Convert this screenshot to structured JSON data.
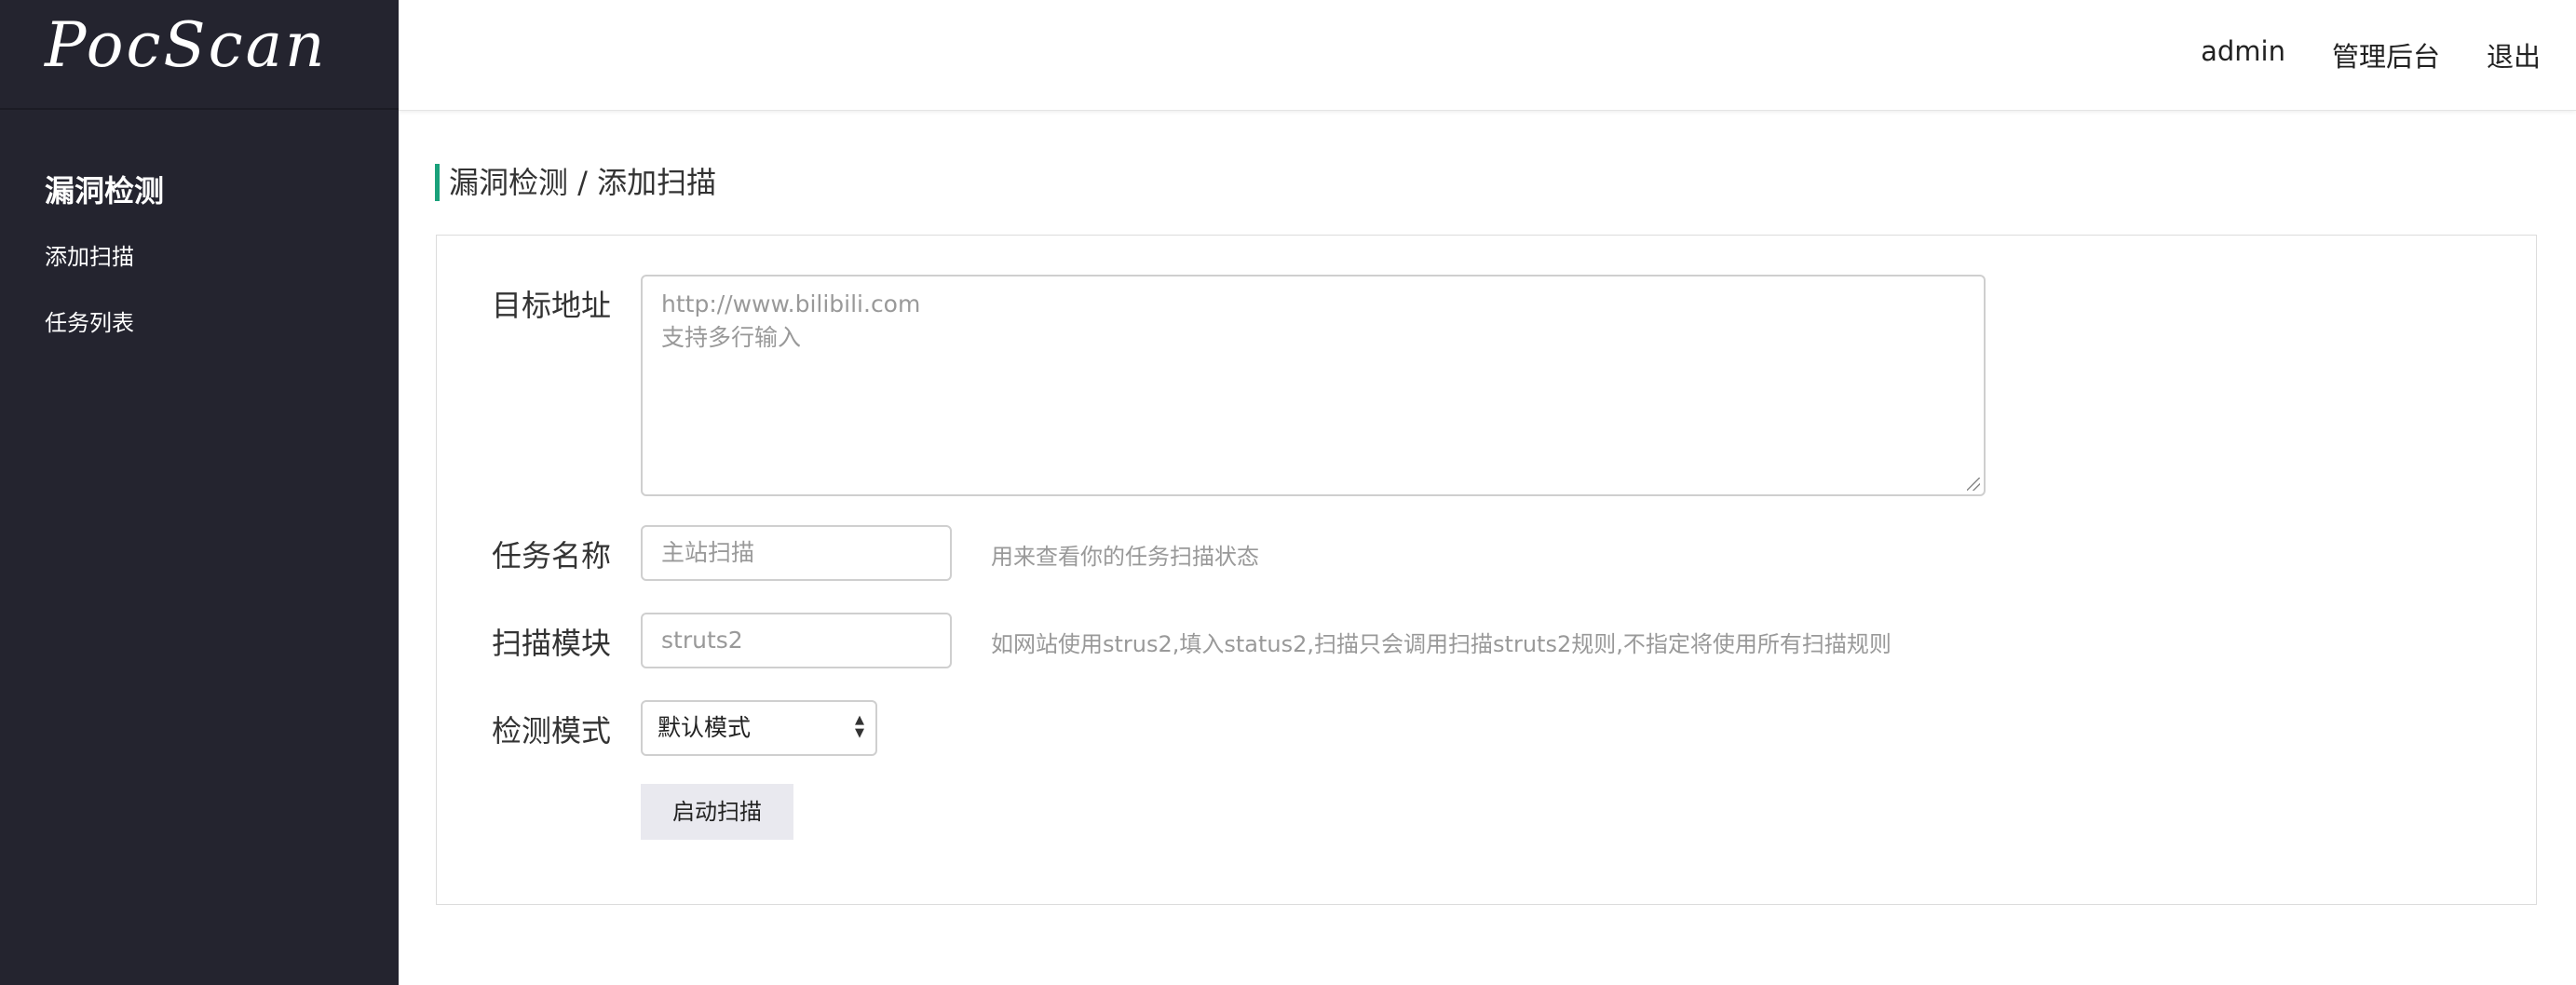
{
  "brand": {
    "logo_text": "PocScan"
  },
  "header": {
    "nav": [
      "admin",
      "管理后台",
      "退出"
    ]
  },
  "sidebar": {
    "section_title": "漏洞检测",
    "items": [
      {
        "label": "添加扫描"
      },
      {
        "label": "任务列表"
      }
    ]
  },
  "breadcrumb": "漏洞检测 / 添加扫描",
  "form": {
    "target": {
      "label": "目标地址",
      "placeholder_line1": "http://www.bilibili.com",
      "placeholder_line2": "支持多行输入"
    },
    "task_name": {
      "label": "任务名称",
      "placeholder": "主站扫描",
      "help": "用来查看你的任务扫描状态"
    },
    "module": {
      "label": "扫描模块",
      "placeholder": "struts2",
      "help": "如网站使用strus2,填入status2,扫描只会调用扫描struts2规则,不指定将使用所有扫描规则"
    },
    "mode": {
      "label": "检测模式",
      "selected": "默认模式"
    },
    "submit_label": "启动扫描"
  },
  "colors": {
    "sidebar_bg": "#24242f",
    "accent": "#1aa17b",
    "button_bg": "#e9e9ef"
  }
}
